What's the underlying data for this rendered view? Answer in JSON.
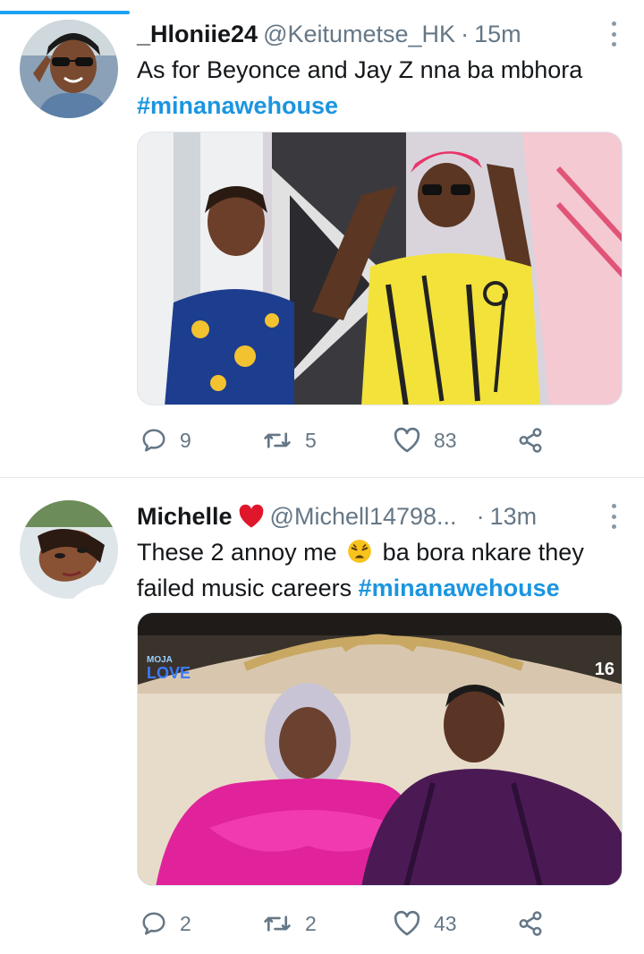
{
  "tweets": [
    {
      "display_name": "_Hloniie24",
      "handle": "@Keitumetse_HK",
      "separator": "·",
      "time": "15m",
      "text": "As for Beyonce and Jay Z nna ba mbhora",
      "hashtag": "#minanawehouse",
      "replies": "9",
      "retweets": "5",
      "likes": "83"
    },
    {
      "display_name": "Michelle",
      "handle": "@Michell14798...",
      "separator": "·",
      "time": "13m",
      "text_line1_a": "These 2 annoy me",
      "text_line1_b": "ba bora nkare they",
      "text_line2": "failed music careers",
      "hashtag": "#minanawehouse",
      "media_logo_top": "MOJA",
      "media_logo_bottom": "LOVE",
      "media_channel": "16",
      "replies": "2",
      "retweets": "2",
      "likes": "43"
    }
  ],
  "icons": {
    "reply": "reply-icon",
    "retweet": "retweet-icon",
    "like": "like-icon",
    "share": "share-icon",
    "more": "more-icon"
  },
  "colors": {
    "accent": "#1da1f2",
    "hashtag": "#1b95e0",
    "muted": "#657786",
    "divider": "#e1e8ed"
  }
}
